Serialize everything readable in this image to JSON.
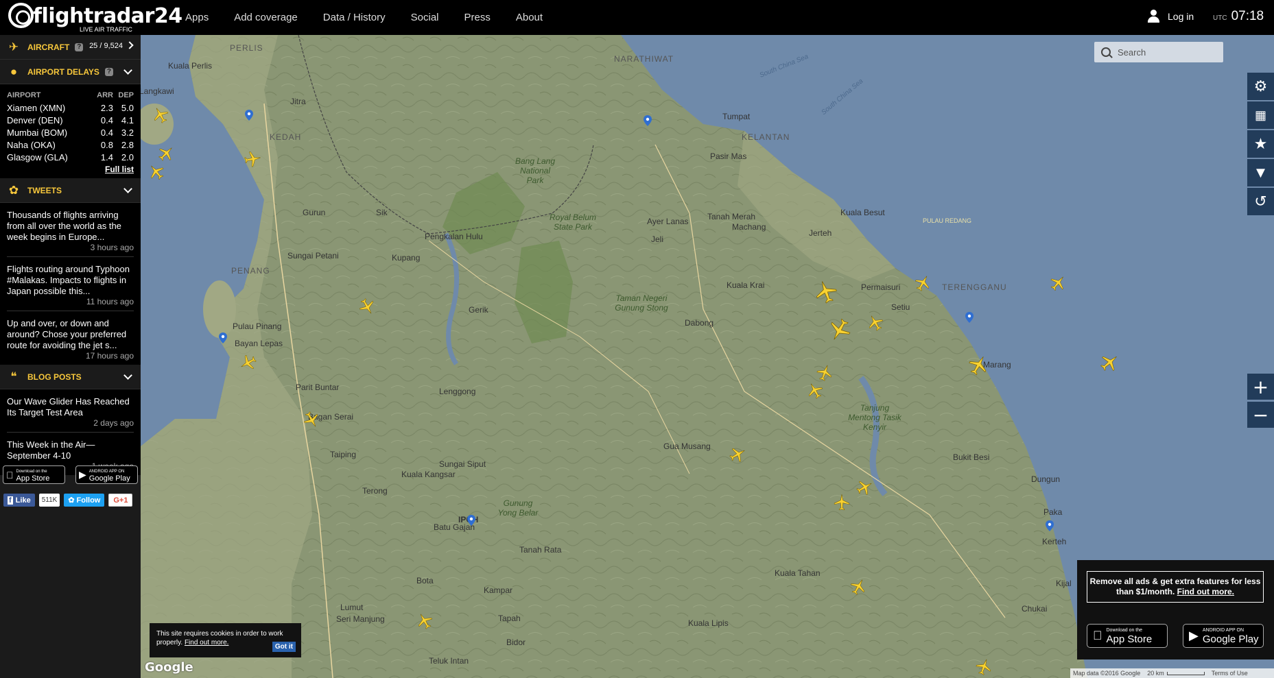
{
  "header": {
    "logo_name": "flightradar24",
    "logo_tagline": "LIVE AIR TRAFFIC",
    "nav": [
      "Apps",
      "Add coverage",
      "Data / History",
      "Social",
      "Press",
      "About"
    ],
    "login_label": "Log in",
    "utc_label": "UTC",
    "time": "07:18"
  },
  "sidebar": {
    "aircraft": {
      "title": "AIRCRAFT",
      "help": "?",
      "count": "25 / 9,524"
    },
    "delays": {
      "title": "AIRPORT DELAYS",
      "help": "?",
      "columns": [
        "AIRPORT",
        "ARR",
        "DEP"
      ],
      "rows": [
        {
          "airport": "Xiamen (XMN)",
          "arr": "2.3",
          "dep": "5.0"
        },
        {
          "airport": "Denver (DEN)",
          "arr": "0.4",
          "dep": "4.1"
        },
        {
          "airport": "Mumbai (BOM)",
          "arr": "0.4",
          "dep": "3.2"
        },
        {
          "airport": "Naha (OKA)",
          "arr": "0.8",
          "dep": "2.8"
        },
        {
          "airport": "Glasgow (GLA)",
          "arr": "1.4",
          "dep": "2.0"
        }
      ],
      "full_list": "Full list"
    },
    "tweets": {
      "title": "TWEETS",
      "items": [
        {
          "text": "Thousands of flights arriving from all over the world as the week begins in Europe...",
          "time": "3 hours ago"
        },
        {
          "text": "Flights routing around Typhoon #Malakas. Impacts to flights in Japan possible this...",
          "time": "11 hours ago"
        },
        {
          "text": "Up and over, or down and around? Chose your preferred route for avoiding the jet s...",
          "time": "17 hours ago"
        }
      ]
    },
    "blog": {
      "title": "BLOG POSTS",
      "items": [
        {
          "text": "Our Wave Glider Has Reached Its Target Test Area",
          "time": "2 days ago"
        },
        {
          "text": "This Week in the Air— September 4-10",
          "time": "1 week ago"
        }
      ]
    },
    "stores": {
      "appstore_small": "Download on the",
      "appstore_big": "App Store",
      "googleplay_small": "ANDROID APP ON",
      "googleplay_big": "Google Play"
    },
    "social": {
      "like": "Like",
      "like_count": "511K",
      "follow": "Follow",
      "gplus": "G+1"
    }
  },
  "map": {
    "search_placeholder": "Search",
    "labels": {
      "perlis": "PERLIS",
      "narathiwat": "NARATHIWAT",
      "kedah": "KEDAH",
      "kelantan": "KELANTAN",
      "penang": "PENANG",
      "terengganu": "TERENGGANU",
      "south_china_sea_1": "South China Sea",
      "south_china_sea_2": "South China Sea",
      "kuala_perlis": "Kuala Perlis",
      "langkawi": "Langkawi",
      "jitra": "Jitra",
      "tumpat": "Tumpat",
      "pasir_mas": "Pasir Mas",
      "tanah_merah": "Tanah Merah",
      "machang": "Machang",
      "kuala_besut": "Kuala Besut",
      "jerteh": "Jerteh",
      "pulau_redang": "PULAU REDANG",
      "permaisuri": "Permaisuri",
      "setiu": "Setiu",
      "gurun": "Gurun",
      "sik": "Sik",
      "sungai_petani": "Sungai Petani",
      "kupang": "Kupang",
      "pengkalan_hulu": "Pengkalan Hulu",
      "ayer_lanas": "Ayer Lanas",
      "jeli": "Jeli",
      "kuala_krai": "Kuala Krai",
      "dabong": "Dabong",
      "gerik": "Gerik",
      "pulau_pinang": "Pulau Pinang",
      "bayan_lepas": "Bayan Lepas",
      "parit_buntar": "Parit Buntar",
      "lenggong": "Lenggong",
      "bagan_serai": "Bagan Serai",
      "taiping": "Taiping",
      "kuala_kangsar": "Kuala Kangsar",
      "sungai_siput": "Sungai Siput",
      "terong": "Terong",
      "gua_musang": "Gua Musang",
      "marang": "Marang",
      "bukit_besi": "Bukit Besi",
      "dungun": "Dungun",
      "paka": "Paka",
      "kerteh": "Kerteh",
      "kijal": "Kijal",
      "chukai": "Chukai",
      "kuala_tahan": "Kuala Tahan",
      "kuala_lipis": "Kuala Lipis",
      "batu_gajah": "Batu Gajah",
      "bota": "Bota",
      "kampar": "Kampar",
      "tapah": "Tapah",
      "tanah_rata": "Tanah Rata",
      "lumut": "Lumut",
      "seri_manjung": "Seri Manjung",
      "bidor": "Bidor",
      "teluk_intan": "Teluk Intan",
      "tanjung_mentong": "Tanjung Mentong Tasik Kenyir",
      "royal_belum": "Royal Belum State Park",
      "bang_lang": "Bang Lang National Park",
      "taman_negeri": "Taman Negeri Gunung Stong",
      "gunung_yong_belar": "Gunung Yong Belar",
      "ipoh": "IPOH"
    }
  },
  "controls": {
    "tools": [
      "settings-icon",
      "widgets-icon",
      "favorites-icon",
      "filter-icon",
      "playback-icon"
    ],
    "zoom_in": "+",
    "zoom_out": "−"
  },
  "promo": {
    "text": "Remove all ads & get extra features for less than $1/month.",
    "link": "Find out more.",
    "appstore_small": "Download on the",
    "appstore_big": "App Store",
    "googleplay_small": "ANDROID APP ON",
    "googleplay_big": "Google Play"
  },
  "cookie": {
    "text": "This site requires cookies in order to work properly.",
    "link": "Find out more.",
    "button": "Got it"
  },
  "footer": {
    "google": "Google",
    "map_data": "Map data ©2016 Google",
    "scale": "20 km",
    "terms": "Terms of Use"
  },
  "colors": {
    "accent": "#f7c73b",
    "topbar": "#000000",
    "sidebar": "#1b1b1b",
    "control": "#223c5a",
    "sea": "#6f8aaa",
    "land": "#8f9a78"
  }
}
